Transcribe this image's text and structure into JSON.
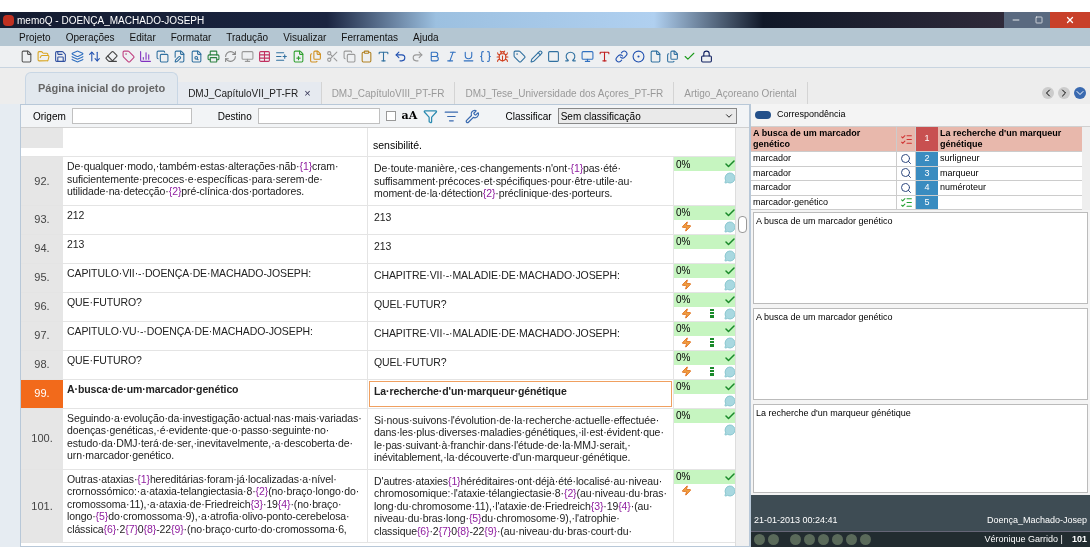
{
  "window": {
    "title": "memoQ - DOENÇA_MACHADO-JOSEPH"
  },
  "menu": [
    "Projeto",
    "Operações",
    "Editar",
    "Formatar",
    "Tradução",
    "Visualizar",
    "Ferramentas",
    "Ajuda"
  ],
  "home_tab": {
    "label": "Página inicial do projeto"
  },
  "tabs": [
    {
      "label": "DMJ_CapítuloVII_PT-FR",
      "selected": true,
      "close": "×"
    },
    {
      "label": "DMJ_CapítuloVIII_PT-FR",
      "selected": false
    },
    {
      "label": "DMJ_Tese_Universidade dos Açores_PT-FR",
      "selected": false
    },
    {
      "label": "Artigo_Açoreano Oriental",
      "selected": false
    }
  ],
  "filter": {
    "source_label": "Origem",
    "target_label": "Destino",
    "case_checked": false,
    "case_label": "aA",
    "sort_label": "Classificar",
    "sort_value": "Sem classificação"
  },
  "cut_row": {
    "target": "sensibilité."
  },
  "rows": [
    {
      "number": "92.",
      "source": "De·qualquer·modo,·também·estas·alterações·nãb·{1}cram·suficientemente·precoces·e·específicas·para·serem·de·utilidade·na·detecção·{2}pré-clínica·dos·portadores.",
      "target": "De·toute·manière,·ces·changements·n'ont·{1}pas·été·suffisamment·précoces·et·spécifiques·pour·être·utile·au·moment·de·la·détection{2}·préclinique·des·porteurs.",
      "match": "0%",
      "confirmed": true,
      "edited": false,
      "repetition": false,
      "selected": false
    },
    {
      "number": "93.",
      "source": "212",
      "target": "213",
      "match": "0%",
      "confirmed": true,
      "edited": true,
      "repetition": false,
      "selected": false
    },
    {
      "number": "94.",
      "source": "213",
      "target": "213",
      "match": "0%",
      "confirmed": true,
      "edited": false,
      "repetition": false,
      "selected": false
    },
    {
      "number": "95.",
      "source": "CAPITULO·VII·-·DOENÇA·DE·MACHADO-JOSEPH:",
      "target": "CHAPITRE·VII·-·MALADIE·DE·MACHADO·JOSEPH:",
      "match": "0%",
      "confirmed": true,
      "edited": true,
      "repetition": false,
      "selected": false
    },
    {
      "number": "96.",
      "source": "QUE·FUTURO?",
      "target": "QUEL·FUTUR?",
      "match": "0%",
      "confirmed": true,
      "edited": true,
      "repetition": true,
      "selected": false
    },
    {
      "number": "97.",
      "source": "CAPITULO·VU·-·DOENÇA·DE·MACHADO-JOSEPH:",
      "target": "CHAPITRE·VII·-·MALADIE·DE·MACHADO·JOSEPH:",
      "match": "0%",
      "confirmed": true,
      "edited": true,
      "repetition": true,
      "selected": false
    },
    {
      "number": "98.",
      "source": "QUE·FUTURO?",
      "target": "QUEL·FUTUR?",
      "match": "0%",
      "confirmed": true,
      "edited": true,
      "repetition": true,
      "selected": false
    },
    {
      "number": "99.",
      "source": "A·busca·de·um·marcador·genético",
      "target": "La·recherche·d'un·marqueur·génétique",
      "match": "0%",
      "confirmed": true,
      "edited": false,
      "repetition": false,
      "selected": true
    },
    {
      "number": "100.",
      "source": "Seguindo·a·evolução·da·investigação·actual·nas·mais·variadas·doenças·genéticas,·é·evidente·que·o·passo·seguinte·no·estudo·da·DMJ·terá·de·ser,·inevitavelmente,·a·descoberta·de·urn·marcador·genético.",
      "target": "Si·nous·suivons·l'évolution·de·la·recherche·actuelle·effectuée·dans·les·plus·diverses·maladies·génétiques,·il·est·évident·que·le·pas·suivant·à·franchir·dans·l'étude·de·la·MMJ·serait,·inévitablement,·la·découverte·d'un·marqueur·génétique.",
      "match": "0%",
      "confirmed": true,
      "edited": false,
      "repetition": false,
      "selected": false
    },
    {
      "number": "101.",
      "source": "Outras·ataxias·{1}hereditárias·foram·já·localizadas·a·nível·crornossómico:·a·ataxia-telangiectasia·8·{2}(no·braço·longo·do·cromossoma·11),·a·ataxia·de·Friedreich{3}·19{4}·(no·braço·longo·{5}do·cromossoma·9),·a·atrofia·olivo-ponto-cerebelosa·clássica{6}·2{7}0{8}-22{9}·(no·braço·curto·do·cromossoma·6,",
      "target": "D'autres·ataxies{1}héréditaires·ont·déjà·été·localisé·au·niveau·chromosomique:·l'ataxie·télangiectasie·8·{2}(au·niveau·du·bras·long·du·chromosome·11),·l'ataxie·de·Friedreich{3}·19{4}·(au·niveau·du·bras·long·{5}du·chromosome·9),·l'atrophie·classique{6}·2{7}0{8}-22{9}·(au·niveau·du·bras·court·du·",
      "match": "0%",
      "confirmed": true,
      "edited": true,
      "repetition": false,
      "selected": false
    }
  ],
  "panel": {
    "title": "Correspondência",
    "results": [
      {
        "source": "A busca de um marcador genético",
        "kind": "checklist",
        "number": "1",
        "target": "La recherche d'un marqueur génétique",
        "selected": true
      },
      {
        "source": "marcador",
        "kind": "lookup",
        "number": "2",
        "target": "surligneur",
        "selected": false
      },
      {
        "source": "marcador",
        "kind": "lookup",
        "number": "3",
        "target": "marqueur",
        "selected": false
      },
      {
        "source": "marcador",
        "kind": "lookup",
        "number": "4",
        "target": "numéroteur",
        "selected": false
      },
      {
        "source": "marcador·genético",
        "kind": "confirmed",
        "number": "5",
        "selected": false
      }
    ],
    "source_preview": "A busca de um marcador genético",
    "compare_preview": "A busca de um marcador genético",
    "target_preview": "La recherche d'un marqueur génétique",
    "date": "21-01-2013 00:24:41",
    "project": "Doença_Machado-Josep",
    "user": "Véronique Garrido |",
    "count": "101"
  }
}
